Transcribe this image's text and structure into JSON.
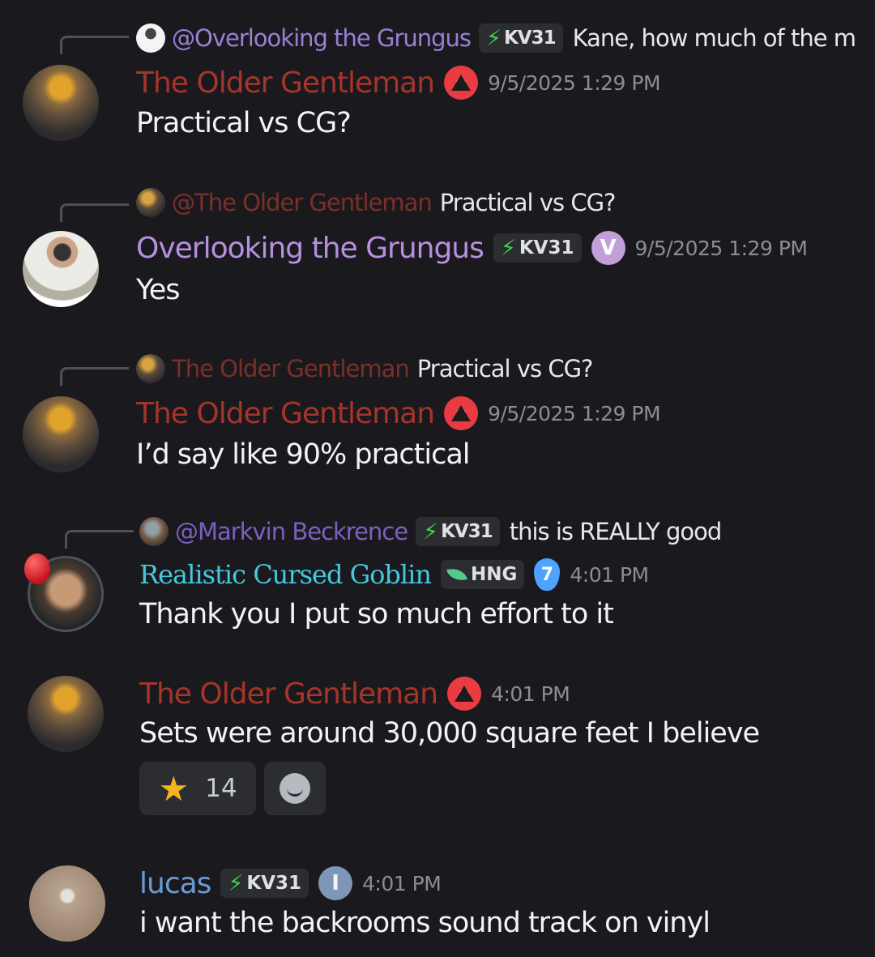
{
  "colors": {
    "background": "#1a1a1e",
    "older_gentleman": "#a6342a",
    "grungus": "#b78fe0",
    "markvin": "#7d5fc1",
    "goblin": "#45c9dd",
    "lucas": "#6b9ad5"
  },
  "messages": [
    {
      "reply": {
        "author": "@Overlooking the Grungus",
        "tag": "KV31",
        "text": "Kane, how much of the m"
      },
      "author": "The Older Gentleman",
      "role_icon": "alert-triangle-icon",
      "time": "9/5/2025 1:29 PM",
      "text": "Practical vs CG?"
    },
    {
      "reply": {
        "author": "@The Older Gentleman",
        "text": "Practical vs CG?"
      },
      "author": "Overlooking the Grungus",
      "tag": "KV31",
      "role_badge": "V",
      "time": "9/5/2025 1:29 PM",
      "text": "Yes"
    },
    {
      "reply": {
        "author": "The Older Gentleman",
        "text": "Practical vs CG?"
      },
      "author": "The Older Gentleman",
      "role_icon": "alert-triangle-icon",
      "time": "9/5/2025 1:29 PM",
      "text": "I’d say like 90% practical"
    },
    {
      "reply": {
        "author": "@Markvin Beckrence",
        "tag": "KV31",
        "text": "this is REALLY good"
      },
      "author": "Realistic Cursed Goblin",
      "tag": "HNG",
      "role_badge": "7",
      "time": "4:01 PM",
      "text": "Thank you I put so much effort to it"
    },
    {
      "author": "The Older Gentleman",
      "role_icon": "alert-triangle-icon",
      "time": "4:01 PM",
      "text": "Sets were around 30,000 square feet I believe",
      "reaction": {
        "emoji": "star-icon",
        "count": "14"
      }
    },
    {
      "author": "lucas",
      "tag": "KV31",
      "role_badge": "I",
      "time": "4:01 PM",
      "text": "i want the backrooms sound track on vinyl"
    }
  ]
}
